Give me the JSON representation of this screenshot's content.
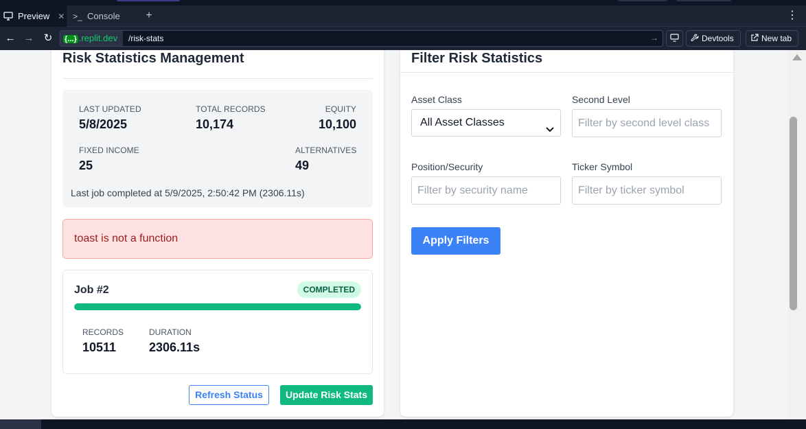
{
  "browser": {
    "tabs": [
      {
        "label": "Preview",
        "icon": "monitor-icon",
        "active": true,
        "close": "✕"
      },
      {
        "label": "Console",
        "icon": "terminal-icon",
        "active": false
      }
    ],
    "add_tab": "+",
    "menu": "⋮",
    "url": {
      "domain_badge": "{...}",
      "domain": ".replit.dev",
      "path": "/risk-stats"
    },
    "devtools_label": "Devtools",
    "newtab_label": "New tab"
  },
  "risk_card": {
    "title": "Risk Statistics Management",
    "stats": {
      "last_updated_label": "LAST UPDATED",
      "last_updated_value": "5/8/2025",
      "total_records_label": "TOTAL RECORDS",
      "total_records_value": "10,174",
      "equity_label": "EQUITY",
      "equity_value": "10,100",
      "fixed_income_label": "FIXED INCOME",
      "fixed_income_value": "25",
      "alternatives_label": "ALTERNATIVES",
      "alternatives_value": "49",
      "last_job": "Last job completed at 5/9/2025, 2:50:42 PM (2306.11s)"
    },
    "error_message": "toast is not a function",
    "job": {
      "title": "Job #2",
      "status": "COMPLETED",
      "progress": 1.0,
      "records_label": "RECORDS",
      "records_value": "10511",
      "duration_label": "DURATION",
      "duration_value": "2306.11s"
    },
    "refresh_button": "Refresh Status",
    "update_button": "Update Risk Stats"
  },
  "filter_card": {
    "title": "Filter Risk Statistics",
    "asset_class_label": "Asset Class",
    "asset_class_value": "All Asset Classes",
    "second_level_label": "Second Level",
    "second_level_placeholder": "Filter by second level class",
    "position_label": "Position/Security",
    "position_placeholder": "Filter by security name",
    "ticker_label": "Ticker Symbol",
    "ticker_placeholder": "Filter by ticker symbol",
    "apply_button": "Apply Filters"
  },
  "colors": {
    "accent_blue": "#3b82f6",
    "success_green": "#10b981",
    "error_bg": "#fee2e2",
    "ide_dark": "#0e1525"
  }
}
